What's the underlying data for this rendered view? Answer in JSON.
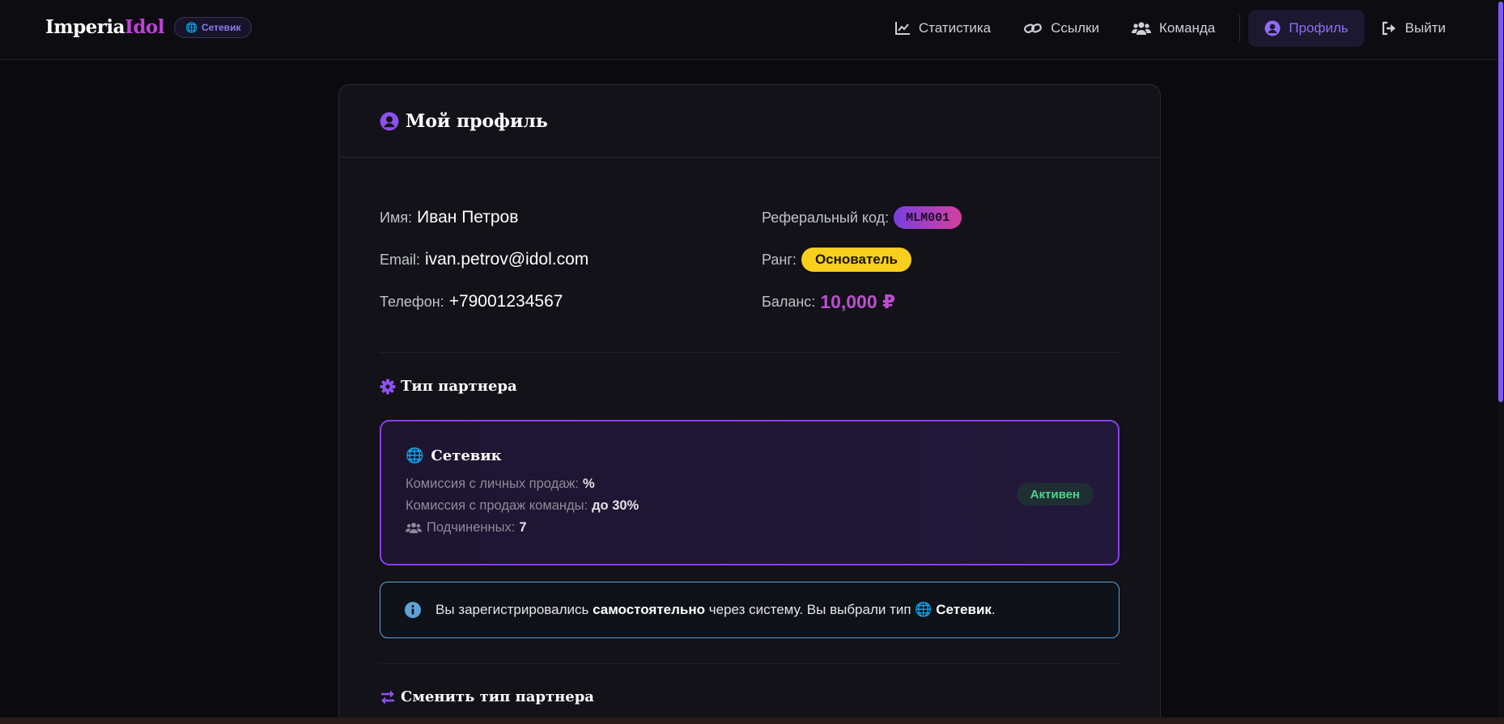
{
  "brand": {
    "name_part1": "Imperia",
    "name_part2": "Idol",
    "badge": "Сетевик"
  },
  "nav": {
    "items": [
      {
        "label": "Статистика",
        "icon": "chart-line-icon"
      },
      {
        "label": "Ссылки",
        "icon": "link-icon"
      },
      {
        "label": "Команда",
        "icon": "users-icon"
      },
      {
        "label": "Профиль",
        "icon": "user-circle-icon",
        "active": true
      },
      {
        "label": "Выйти",
        "icon": "sign-out-icon"
      }
    ]
  },
  "profile": {
    "title": "Мой профиль",
    "name_label": "Имя:",
    "name": "Иван Петров",
    "email_label": "Email:",
    "email": "ivan.petrov@idol.com",
    "phone_label": "Телефон:",
    "phone": "+79001234567",
    "ref_label": "Реферальный код:",
    "ref_code": "MLM001",
    "rank_label": "Ранг:",
    "rank": "Основатель",
    "balance_label": "Баланс:",
    "balance": "10,000 ₽"
  },
  "partner_type": {
    "section_title": "Тип партнера",
    "name": "Сетевик",
    "personal_commission_label": "Комиссия с личных продаж:",
    "personal_commission": "%",
    "team_commission_label": "Комиссия с продаж команды:",
    "team_commission": "до 30%",
    "subordinates_label": "Подчиненных:",
    "subordinates": "7",
    "status": "Активен"
  },
  "alert": {
    "text1": "Вы зарегистрировались ",
    "bold1": "самостоятельно",
    "text2": " через систему. Вы выбрали тип ",
    "bold2": "Сетевик",
    "text3": "."
  },
  "change_type": {
    "section_title": "Сменить тип партнера"
  },
  "colors": {
    "accent": "#8a3ff0",
    "brand_pink": "#c040d8",
    "rank_yellow": "#f7cf1c",
    "status_green": "#4cd48a",
    "info_blue": "#5ea3d8"
  }
}
